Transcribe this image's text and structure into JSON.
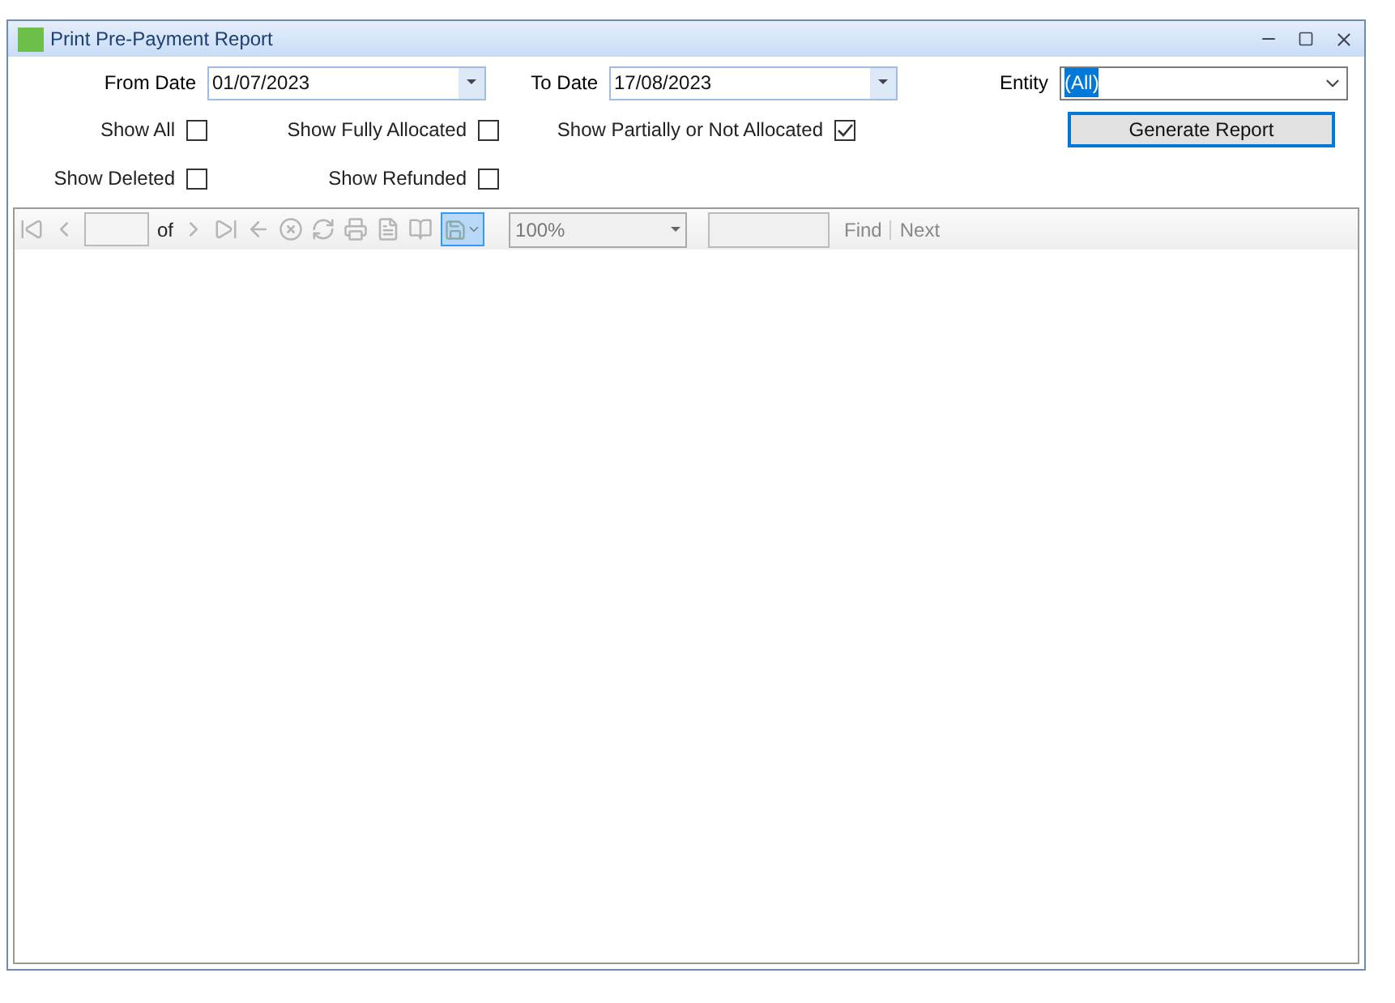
{
  "window": {
    "title": "Print Pre-Payment Report"
  },
  "from_date": {
    "label": "From Date",
    "value": "01/07/2023"
  },
  "to_date": {
    "label": "To Date",
    "value": "17/08/2023"
  },
  "entity": {
    "label": "Entity",
    "value": "(All)"
  },
  "checkboxes": [
    {
      "label": "Show All",
      "checked": false
    },
    {
      "label": "Show Fully Allocated",
      "checked": false
    },
    {
      "label": "Show Partially or Not Allocated",
      "checked": true
    },
    {
      "label": "Show Deleted",
      "checked": false
    },
    {
      "label": "Show Refunded",
      "checked": false
    }
  ],
  "generate_button": "Generate Report",
  "toolbar": {
    "page_of": "of",
    "zoom": "100%",
    "find": "Find",
    "next": "Next"
  }
}
